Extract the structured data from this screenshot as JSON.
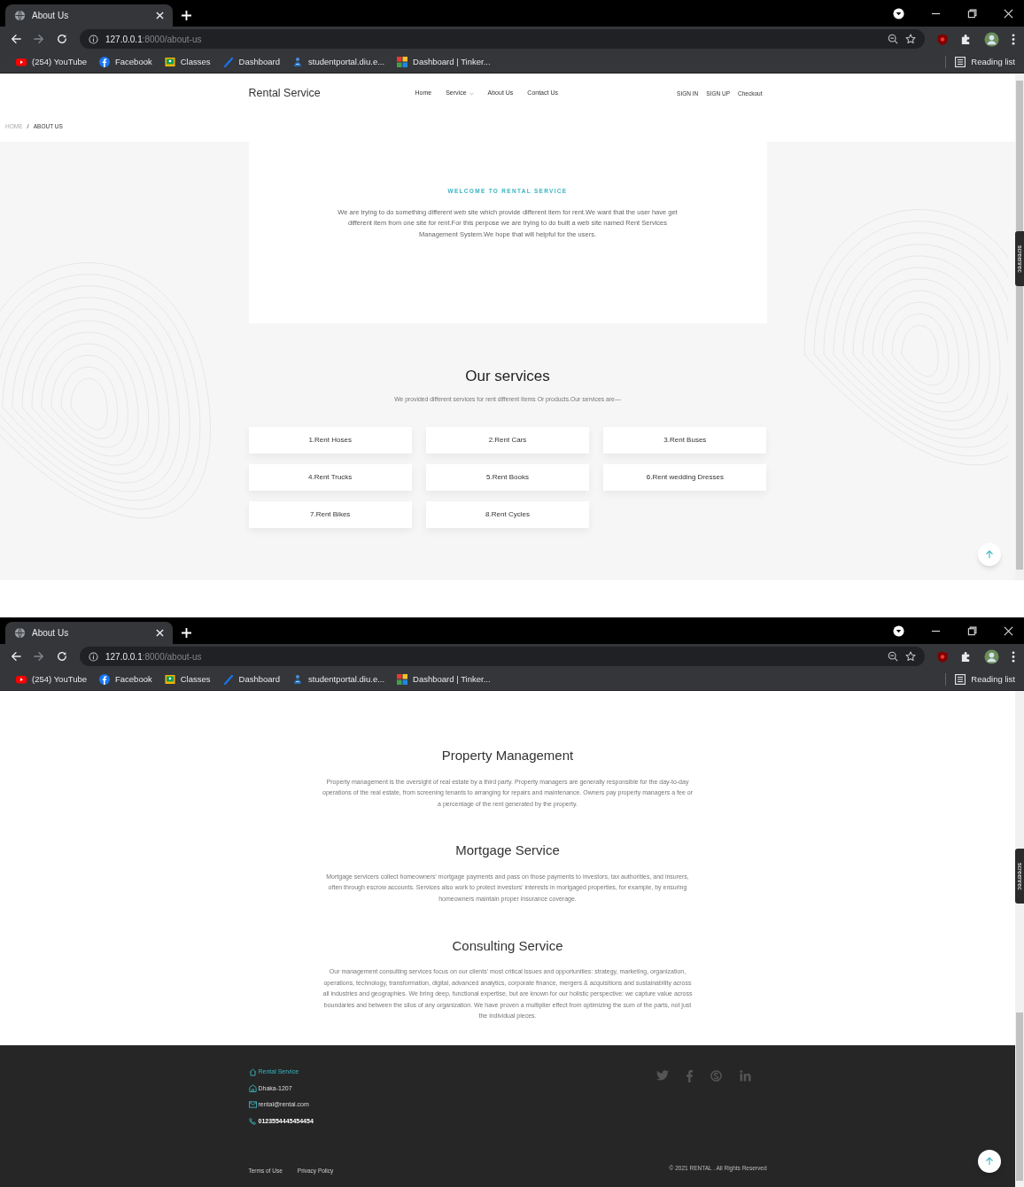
{
  "windows": [
    {
      "browser": {
        "tab_title": "About Us",
        "url_host": "127.0.0.1",
        "url_rest": ":8000/about-us",
        "bookmarks": [
          {
            "label": "(254) YouTube",
            "kind": "youtube"
          },
          {
            "label": "Facebook",
            "kind": "facebook"
          },
          {
            "label": "Classes",
            "kind": "classroom"
          },
          {
            "label": "Dashboard",
            "kind": "dashboard"
          },
          {
            "label": "studentportal.diu.e...",
            "kind": "portal"
          },
          {
            "label": "Dashboard | Tinker...",
            "kind": "tinker"
          }
        ],
        "reading_list": "Reading list"
      },
      "recorder_tab": "screenrec",
      "page": {
        "kind": "about",
        "header": {
          "brand": "Rental Service",
          "nav": [
            {
              "label": "Home",
              "dropdown": false
            },
            {
              "label": "Service",
              "dropdown": true
            },
            {
              "label": "About Us",
              "dropdown": false
            },
            {
              "label": "Contact Us",
              "dropdown": false
            }
          ],
          "account_links": [
            "SIGN IN",
            "SIGN UP",
            "Checkout"
          ]
        },
        "breadcrumb": {
          "separator": "/",
          "items": [
            {
              "label": "HOME",
              "current": false
            },
            {
              "label": "ABOUT US",
              "current": true
            }
          ]
        },
        "welcome": {
          "eyebrow": "WELCOME TO RENTAL SERVICE",
          "text": "We are trying to do something different web site which provide different item for rent.We want that the user have get different item from one site for rent.For this perpose we are trying to do built a web site named Rent Services Management System.We hope that will helpful for the users."
        },
        "services": {
          "title": "Our services",
          "subtitle": "We provided different services for rent different Items Or products.Our services are—",
          "items": [
            "1.Rent Hoses",
            "2.Rent Cars",
            "3.Rent Buses",
            "4.Rent Trucks",
            "5.Rent Books",
            "6.Rent wedding Dresses",
            "7.Rent Bikes",
            "8.Rent Cycles"
          ]
        }
      }
    },
    {
      "browser": {
        "tab_title": "About Us",
        "url_host": "127.0.0.1",
        "url_rest": ":8000/about-us",
        "bookmarks": [
          {
            "label": "(254) YouTube",
            "kind": "youtube"
          },
          {
            "label": "Facebook",
            "kind": "facebook"
          },
          {
            "label": "Classes",
            "kind": "classroom"
          },
          {
            "label": "Dashboard",
            "kind": "dashboard"
          },
          {
            "label": "studentportal.diu.e...",
            "kind": "portal"
          },
          {
            "label": "Dashboard | Tinker...",
            "kind": "tinker"
          }
        ],
        "reading_list": "Reading list"
      },
      "recorder_tab": "screenrec",
      "page": {
        "kind": "details",
        "sections": [
          {
            "title": "Property Management",
            "text": "Property management is the oversight of real estate by a third party. Property managers are generally responsible for the day-to-day operations of the real estate, from screening tenants to arranging for repairs and maintenance. Owners pay property managers a fee or a percentage of the rent generated by the property."
          },
          {
            "title": "Mortgage Service",
            "text": "Mortgage servicers collect homeowners' mortgage payments and pass on those payments to investors, tax authorities, and insurers, often through escrow accounts. Services also work to protect investors' interests in mortgaged properties, for example, by ensuring homeowners maintain proper insurance coverage."
          },
          {
            "title": "Consulting Service",
            "text": "Our management consulting services focus on our clients' most critical issues and opportunities: strategy, marketing, organization, operations, technology, transformation, digital, advanced analytics, corporate finance, mergers & acquisitions and sustainability across all industries and geographies. We bring deep, functional expertise, but are known for our holistic perspective: we capture value across boundaries and between the silos of any organization. We have proven a multiplier effect from optimizing the sum of the parts, not just the individual pieces."
          }
        ],
        "footer": {
          "contacts": [
            {
              "kind": "brand",
              "text": "Rental Service"
            },
            {
              "kind": "address",
              "text": "Dhaka-1207"
            },
            {
              "kind": "email",
              "text": "rental@rental.com"
            },
            {
              "kind": "phone",
              "text": "0123554445454454"
            }
          ],
          "social": [
            {
              "kind": "twitter"
            },
            {
              "kind": "facebook"
            },
            {
              "kind": "skype"
            },
            {
              "kind": "linkedin"
            }
          ],
          "links": [
            "Terms of Use",
            "Privacy Policy"
          ],
          "copyright": "© 2021 RENTAL . All Rights Reserved"
        }
      }
    }
  ]
}
